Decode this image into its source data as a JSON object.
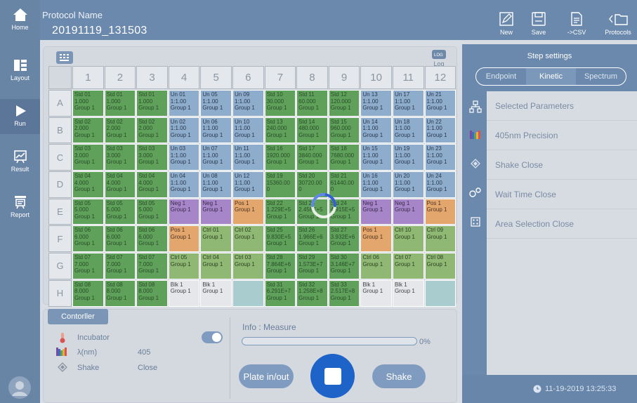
{
  "nav": {
    "home": "Home",
    "layout": "Layout",
    "run": "Run",
    "result": "Result",
    "report": "Report"
  },
  "header": {
    "protocol_label": "Protocol Name",
    "protocol_value": "20191119_131503"
  },
  "toolbar": {
    "new": "New",
    "save": "Save",
    "csv": "->CSV",
    "protocols": "Protocols"
  },
  "plate": {
    "log_label": "Log",
    "columns": [
      "1",
      "2",
      "3",
      "4",
      "5",
      "6",
      "7",
      "8",
      "9",
      "10",
      "11",
      "12"
    ],
    "rows": [
      "A",
      "B",
      "C",
      "D",
      "E",
      "F",
      "G",
      "H"
    ],
    "wells": [
      [
        [
          "std",
          "Std 01",
          "1.000",
          "Group 1"
        ],
        [
          "std",
          "Std 01",
          "1.000",
          "Group 1"
        ],
        [
          "std",
          "Std 01",
          "1.000",
          "Group 1"
        ],
        [
          "un",
          "Un 01",
          "1:1.00",
          "Group 1"
        ],
        [
          "un",
          "Un 05",
          "1:1.00",
          "Group 1"
        ],
        [
          "un",
          "Un 09",
          "1:1.00",
          "Group 1"
        ],
        [
          "std",
          "Std 10",
          "30.000",
          "Group 1"
        ],
        [
          "std",
          "Std 11",
          "60.000",
          "Group 1"
        ],
        [
          "std",
          "Std 12",
          "120.000",
          "Group 1"
        ],
        [
          "un",
          "Un 13",
          "1:1.00",
          "Group 1"
        ],
        [
          "un",
          "Un 17",
          "1:1.00",
          "Group 1"
        ],
        [
          "un",
          "Un 21",
          "1:1.00",
          "Group 1"
        ]
      ],
      [
        [
          "std",
          "Std 02",
          "2.000",
          "Group 1"
        ],
        [
          "std",
          "Std 02",
          "2.000",
          "Group 1"
        ],
        [
          "std",
          "Std 02",
          "2.000",
          "Group 1"
        ],
        [
          "un",
          "Un 02",
          "1:1.00",
          "Group 1"
        ],
        [
          "un",
          "Un 06",
          "1:1.00",
          "Group 1"
        ],
        [
          "un",
          "Un 10",
          "1:1.00",
          "Group 1"
        ],
        [
          "std",
          "Std 13",
          "240.000",
          "Group 1"
        ],
        [
          "std",
          "Std 14",
          "480.000",
          "Group 1"
        ],
        [
          "std",
          "Std 15",
          "960.000",
          "Group 1"
        ],
        [
          "un",
          "Un 14",
          "1:1.00",
          "Group 1"
        ],
        [
          "un",
          "Un 18",
          "1:1.00",
          "Group 1"
        ],
        [
          "un",
          "Un 22",
          "1:1.00",
          "Group 1"
        ]
      ],
      [
        [
          "std",
          "Std 03",
          "3.000",
          "Group 1"
        ],
        [
          "std",
          "Std 03",
          "3.000",
          "Group 1"
        ],
        [
          "std",
          "Std 03",
          "3.000",
          "Group 1"
        ],
        [
          "un",
          "Un 03",
          "1:1.00",
          "Group 1"
        ],
        [
          "un",
          "Un 07",
          "1:1.00",
          "Group 1"
        ],
        [
          "un",
          "Un 11",
          "1:1.00",
          "Group 1"
        ],
        [
          "std",
          "Std 16",
          "1920.000",
          "Group 1"
        ],
        [
          "std",
          "Std 17",
          "3840.000",
          "Group 1"
        ],
        [
          "std",
          "Std 18",
          "7680.000",
          "Group 1"
        ],
        [
          "un",
          "Un 15",
          "1:1.00",
          "Group 1"
        ],
        [
          "un",
          "Un 19",
          "1:1.00",
          "Group 1"
        ],
        [
          "un",
          "Un 23",
          "1:1.00",
          "Group 1"
        ]
      ],
      [
        [
          "std",
          "Std 04",
          "4.000",
          "Group 1"
        ],
        [
          "std",
          "Std 04",
          "4.000",
          "Group 1"
        ],
        [
          "std",
          "Std 04",
          "4.000",
          "Group 1"
        ],
        [
          "un",
          "Un 04",
          "1:1.00",
          "Group 1"
        ],
        [
          "un",
          "Un 08",
          "1:1.00",
          "Group 1"
        ],
        [
          "un",
          "Un 12",
          "1:1.00",
          "Group 1"
        ],
        [
          "std",
          "Std 19",
          "15360.00",
          "0"
        ],
        [
          "std",
          "Std 20",
          "30720.00",
          "0"
        ],
        [
          "std",
          "Std 21",
          "61440.00",
          "0"
        ],
        [
          "un",
          "Un 16",
          "1:1.00",
          "Group 1"
        ],
        [
          "un",
          "Un 20",
          "1:1.00",
          "Group 1"
        ],
        [
          "un",
          "Un 24",
          "1:1.00",
          "Group 1"
        ]
      ],
      [
        [
          "std",
          "Std 05",
          "5.000",
          "Group 1"
        ],
        [
          "std",
          "Std 05",
          "5.000",
          "Group 1"
        ],
        [
          "std",
          "Std 05",
          "5.000",
          "Group 1"
        ],
        [
          "neg",
          "Neg 1",
          "Group 1",
          ""
        ],
        [
          "neg",
          "Neg 1",
          "Group 1",
          ""
        ],
        [
          "pos",
          "Pos 1",
          "Group 1",
          ""
        ],
        [
          "std",
          "Std 22",
          "1.229E+5",
          "Group 1"
        ],
        [
          "std",
          "Std 23",
          "2.458E+5",
          "Group 1"
        ],
        [
          "std",
          "Std 24",
          "4.915E+5",
          "Group 1"
        ],
        [
          "neg",
          "Neg 1",
          "Group 1",
          ""
        ],
        [
          "neg",
          "Neg 1",
          "Group 1",
          ""
        ],
        [
          "pos",
          "Pos 1",
          "Group 1",
          ""
        ]
      ],
      [
        [
          "std",
          "Std 06",
          "6.000",
          "Group 1"
        ],
        [
          "std",
          "Std 06",
          "6.000",
          "Group 1"
        ],
        [
          "std",
          "Std 06",
          "6.000",
          "Group 1"
        ],
        [
          "pos",
          "Pos 1",
          "Group 1",
          ""
        ],
        [
          "ctrl",
          "Ctrl 01",
          "Group 1",
          ""
        ],
        [
          "ctrl",
          "Ctrl 02",
          "Group 1",
          ""
        ],
        [
          "std",
          "Std 25",
          "9.830E+5",
          "Group 1"
        ],
        [
          "std",
          "Std 26",
          "1.966E+6",
          "Group 1"
        ],
        [
          "std",
          "Std 27",
          "3.932E+6",
          "Group 1"
        ],
        [
          "pos",
          "Pos 1",
          "Group 1",
          ""
        ],
        [
          "ctrl",
          "Ctrl 10",
          "Group 1",
          ""
        ],
        [
          "ctrl",
          "Ctrl 09",
          "Group 1",
          ""
        ]
      ],
      [
        [
          "std",
          "Std 07",
          "7.000",
          "Group 1"
        ],
        [
          "std",
          "Std 07",
          "7.000",
          "Group 1"
        ],
        [
          "std",
          "Std 07",
          "7.000",
          "Group 1"
        ],
        [
          "ctrl",
          "Ctrl 05",
          "Group 1",
          ""
        ],
        [
          "ctrl",
          "Ctrl 04",
          "Group 1",
          ""
        ],
        [
          "ctrl",
          "Ctrl 03",
          "Group 1",
          ""
        ],
        [
          "std",
          "Std 28",
          "7.864E+6",
          "Group 1"
        ],
        [
          "std",
          "Std 29",
          "1.573E+7",
          "Group 1"
        ],
        [
          "std",
          "Std 30",
          "3.146E+7",
          "Group 1"
        ],
        [
          "ctrl",
          "Ctrl 06",
          "Group 1",
          ""
        ],
        [
          "ctrl",
          "Ctrl 07",
          "Group 1",
          ""
        ],
        [
          "ctrl",
          "Ctrl 08",
          "Group 1",
          ""
        ]
      ],
      [
        [
          "std",
          "Std 08",
          "8.000",
          "Group 1"
        ],
        [
          "std",
          "Std 08",
          "8.000",
          "Group 1"
        ],
        [
          "std",
          "Std 08",
          "8.000",
          "Group 1"
        ],
        [
          "blk",
          "Blk 1",
          "Group 1",
          ""
        ],
        [
          "blk",
          "Blk 1",
          "Group 1",
          ""
        ],
        [
          "empty",
          "",
          "",
          ""
        ],
        [
          "std",
          "Std 31",
          "6.291E+7",
          "Group 1"
        ],
        [
          "std",
          "Std 32",
          "1.258E+8",
          "Group 1"
        ],
        [
          "std",
          "Std 33",
          "2.517E+8",
          "Group 1"
        ],
        [
          "blk",
          "Blk 1",
          "Group 1",
          ""
        ],
        [
          "blk",
          "Blk 1",
          "Group 1",
          ""
        ],
        [
          "empty",
          "",
          "",
          ""
        ]
      ]
    ]
  },
  "controller": {
    "tab": "Contorller",
    "incubator_label": "Incubator",
    "incubator_on": true,
    "wavelength_label": "λ(nm)",
    "wavelength_value": "405",
    "shake_label": "Shake",
    "shake_value": "Close",
    "info_label": "Info : Measure",
    "progress_text": "0%",
    "progress": 0,
    "plate_btn": "Plate in/out",
    "shake_btn": "Shake"
  },
  "step": {
    "title": "Step settings",
    "modes": [
      "Endpoint",
      "Kinetic",
      "Spectrum"
    ],
    "active_mode": "Kinetic",
    "params": [
      "Selected Parameters",
      "405nm  Precision",
      "Shake Close",
      "Wait Time Close",
      "Area Selection Close"
    ]
  },
  "datetime": "11-19-2019 13:25:33"
}
